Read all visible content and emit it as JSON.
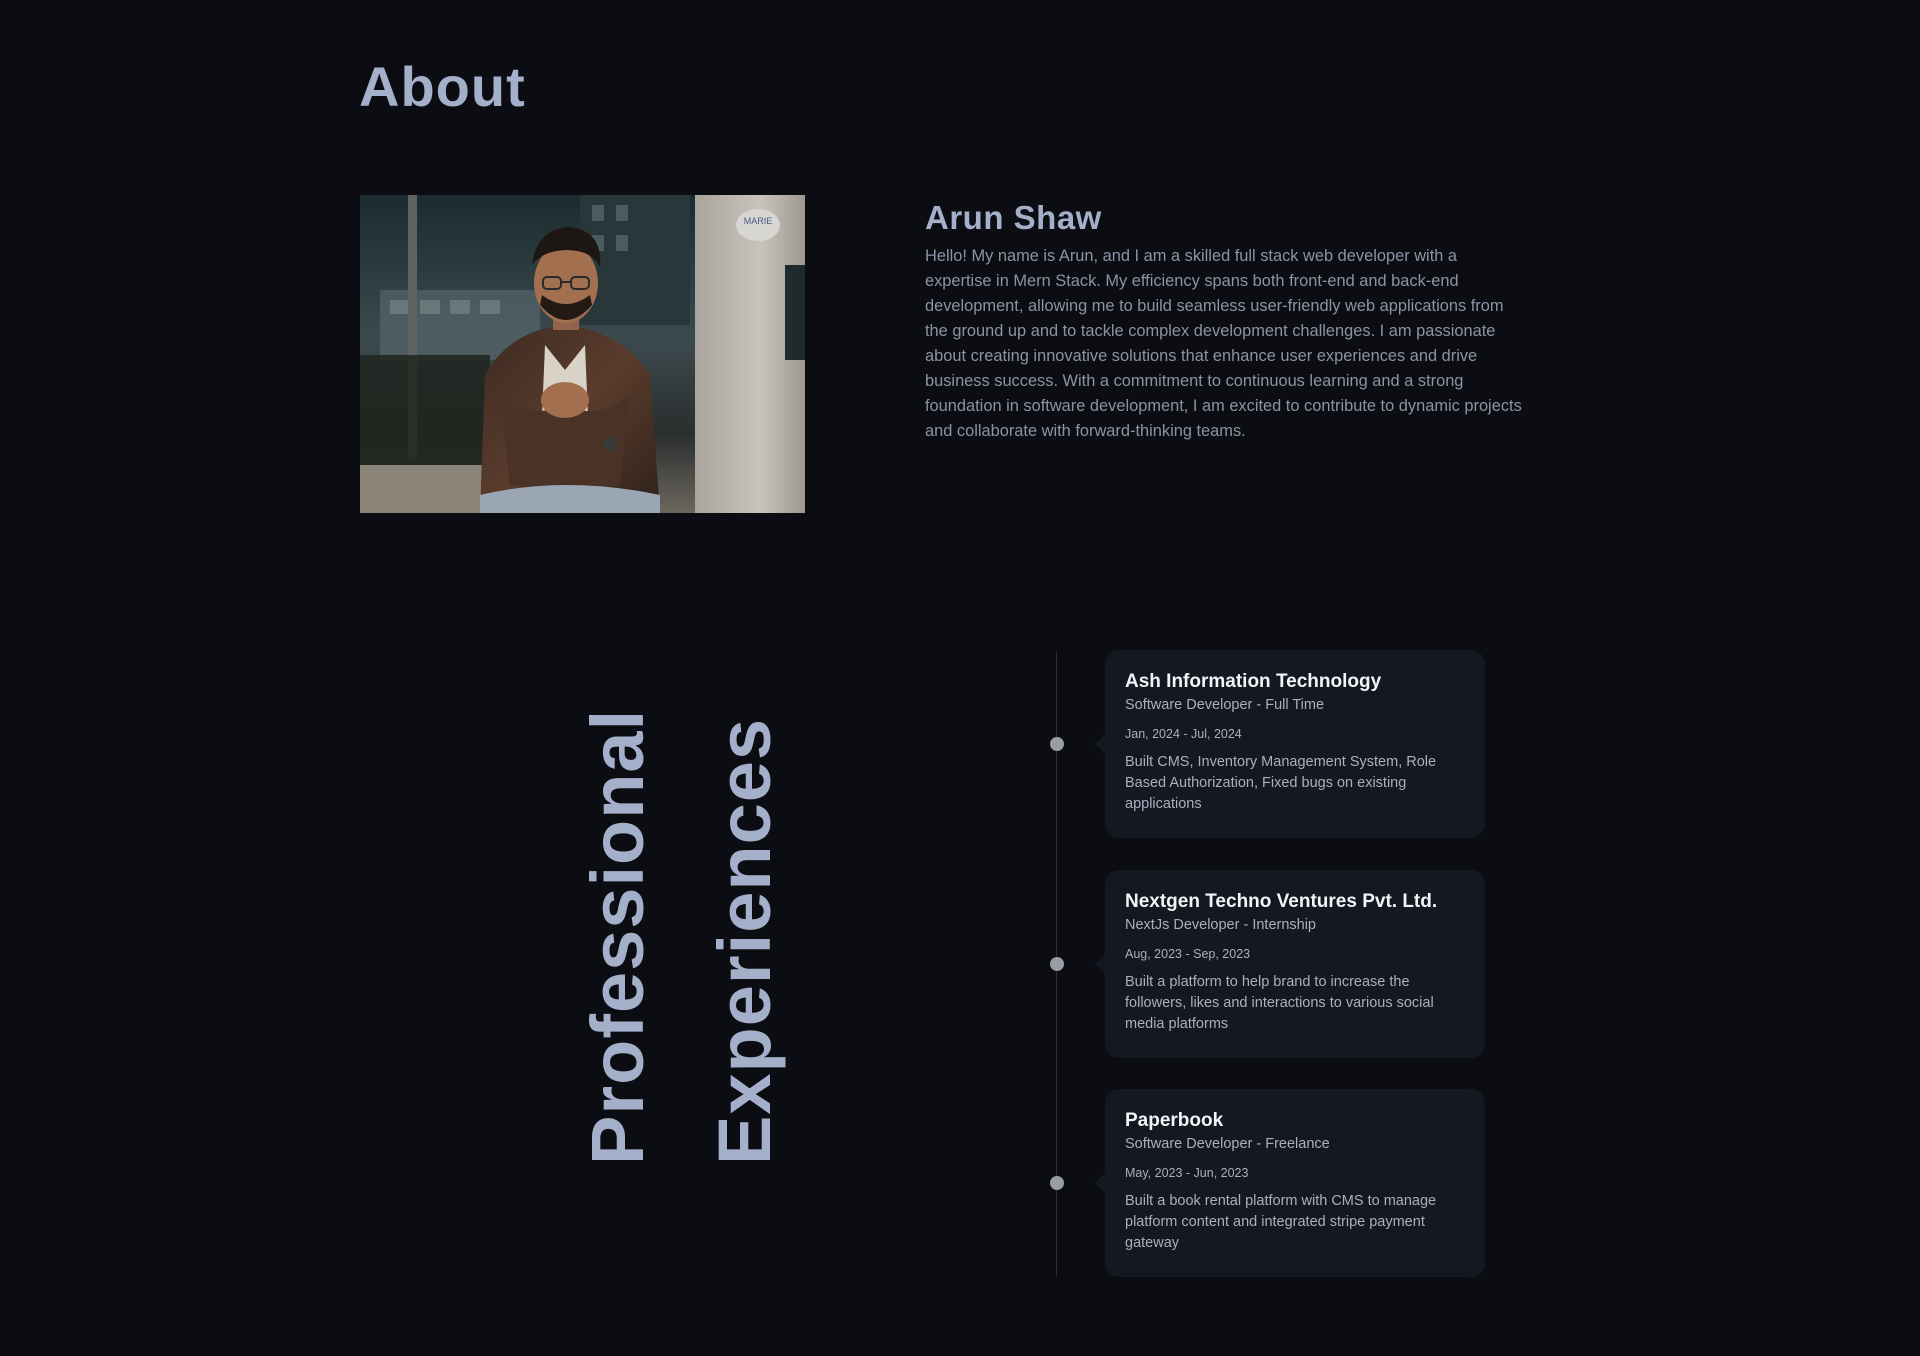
{
  "about": {
    "title": "About",
    "name": "Arun Shaw",
    "bio": "Hello! My name is Arun, and I am a skilled full stack web developer with a expertise in Mern Stack. My efficiency spans both front-end and back-end development, allowing me to build seamless user-friendly web applications from the ground up and to tackle complex development challenges. I am passionate about creating innovative solutions that enhance user experiences and drive business success. With a commitment to continuous learning and a strong foundation in software development, I am excited to contribute to dynamic projects and collaborate with forward-thinking teams.",
    "photo_sign_text": "MARIE"
  },
  "experience": {
    "heading_word_1": "Professional",
    "heading_word_2": "Experiences",
    "items": [
      {
        "company": "Ash Information Technology",
        "role": "Software Developer - Full Time",
        "dates": "Jan, 2024 - Jul, 2024",
        "description": "Built CMS, Inventory Management System, Role Based Authorization, Fixed bugs on existing applications"
      },
      {
        "company": "Nextgen Techno Ventures Pvt. Ltd.",
        "role": "NextJs Developer - Internship",
        "dates": "Aug, 2023 - Sep, 2023",
        "description": "Built a platform to help brand to increase the followers, likes and interactions to various social media platforms"
      },
      {
        "company": "Paperbook",
        "role": "Software Developer - Freelance",
        "dates": "May, 2023 - Jun, 2023",
        "description": "Built a book rental platform with CMS to manage platform content and integrated stripe payment gateway"
      }
    ]
  },
  "colors": {
    "background": "#0b0d13",
    "heading": "#a4afc9",
    "card": "#131821",
    "dot": "#9a9da5"
  }
}
